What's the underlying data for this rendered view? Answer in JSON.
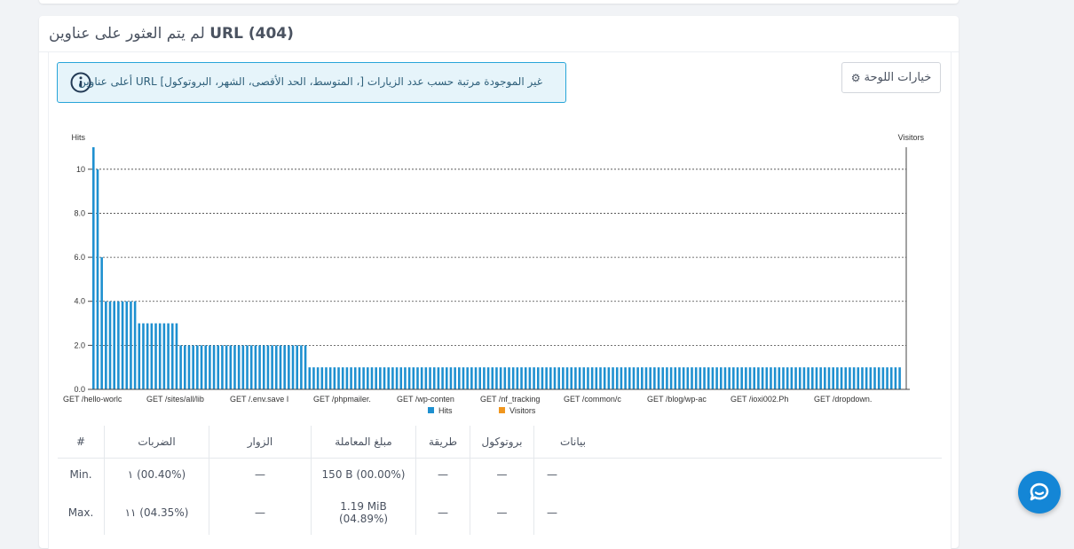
{
  "panel": {
    "title_arabic": "لم يتم العثور على عناوين",
    "title_url": "URL (404)",
    "info_text": "غير الموجودة مرتبة حسب عدد الزيارات [، المتوسط، الحد الأقصى، الشهر، البروتوكول] URL أعلى عناوين",
    "options_label": "خيارات اللوحة",
    "options_icon": "gear-icon",
    "info_icon": "info-circle-icon"
  },
  "chart_data": {
    "type": "bar",
    "y_left_label": "Hits",
    "y_right_label": "Visitors",
    "ylim": [
      0,
      11
    ],
    "yticks": [
      "0.0",
      "2.0",
      "4.0",
      "6.0",
      "8.0",
      "10"
    ],
    "grid": true,
    "legend_placement": "bottom",
    "x_tick_labels": [
      "GET /hello-worlc",
      "GET /sites/all/lib",
      "GET /.env.save I",
      "GET /phpmailer.",
      "GET /wp-conten",
      "GET /nf_tracking",
      "GET /common/c",
      "GET /blog/wp-ac",
      "GET /ioxi002.Ph",
      "GET /dropdown."
    ],
    "series": [
      {
        "name": "Hits",
        "color": "#1e90d0",
        "values": [
          11,
          10,
          6,
          4,
          4,
          4,
          4,
          4,
          4,
          4,
          4,
          3,
          3,
          3,
          3,
          3,
          3,
          3,
          3,
          3,
          3,
          2,
          2,
          2,
          2,
          2,
          2,
          2,
          2,
          2,
          2,
          2,
          2,
          2,
          2,
          2,
          2,
          2,
          2,
          2,
          2,
          2,
          2,
          2,
          2,
          2,
          2,
          2,
          2,
          2,
          2,
          2,
          1,
          1,
          1,
          1,
          1,
          1,
          1,
          1,
          1,
          1,
          1,
          1,
          1,
          1,
          1,
          1,
          1,
          1,
          1,
          1,
          1,
          1,
          1,
          1,
          1,
          1,
          1,
          1,
          1,
          1,
          1,
          1,
          1,
          1,
          1,
          1,
          1,
          1,
          1,
          1,
          1,
          1,
          1,
          1,
          1,
          1,
          1,
          1,
          1,
          1,
          1,
          1,
          1,
          1,
          1,
          1,
          1,
          1,
          1,
          1,
          1,
          1,
          1,
          1,
          1,
          1,
          1,
          1,
          1,
          1,
          1,
          1,
          1,
          1,
          1,
          1,
          1,
          1,
          1,
          1,
          1,
          1,
          1,
          1,
          1,
          1,
          1,
          1,
          1,
          1,
          1,
          1,
          1,
          1,
          1,
          1,
          1,
          1,
          1,
          1,
          1,
          1,
          1,
          1,
          1,
          1,
          1,
          1,
          1,
          1,
          1,
          1,
          1,
          1,
          1,
          1,
          1,
          1,
          1,
          1,
          1,
          1,
          1,
          1,
          1,
          1,
          1,
          1,
          1,
          1,
          1,
          1,
          1,
          1,
          1,
          1,
          1,
          1,
          1,
          1,
          1,
          1,
          1
        ]
      },
      {
        "name": "Visitors",
        "color": "#f0961e",
        "values": []
      }
    ]
  },
  "table": {
    "headers": [
      "#",
      "الضربات",
      "الزوار",
      "مبلغ المعاملة",
      "طريقة",
      "بروتوكول",
      "بيانات"
    ],
    "rows": [
      {
        "label": "Min.",
        "hits": "١ (00.40%)",
        "visitors": "—",
        "tx": "150 B (00.00%)",
        "tx2": "",
        "method": "—",
        "protocol": "—",
        "data": "—"
      },
      {
        "label": "Max.",
        "hits": "١١ (04.35%)",
        "visitors": "—",
        "tx": "1.19 MiB",
        "tx2": "(04.89%)",
        "method": "—",
        "protocol": "—",
        "data": "—"
      }
    ]
  },
  "chat": {
    "icon": "chat-bubble-icon"
  }
}
